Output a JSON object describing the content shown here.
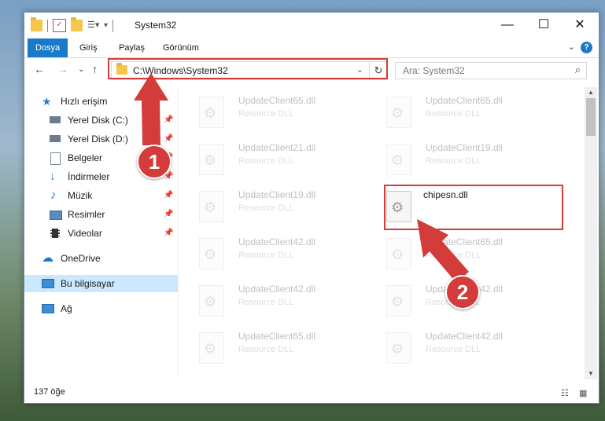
{
  "window": {
    "title": "System32",
    "controls": {
      "minimize": "—",
      "maximize": "☐",
      "close": "✕"
    }
  },
  "ribbon": {
    "tabs": [
      "Dosya",
      "Giriş",
      "Paylaş",
      "Görünüm"
    ],
    "active_tab": "Dosya",
    "help": "?"
  },
  "address": {
    "path": "C:\\Windows\\System32",
    "search_placeholder": "Ara: System32"
  },
  "sidebar": {
    "quick_access": "Hızlı erişim",
    "items": [
      {
        "label": "Yerel Disk (C:)",
        "icon": "drive-icon",
        "pinned": true
      },
      {
        "label": "Yerel Disk (D:)",
        "icon": "drive-icon",
        "pinned": true
      },
      {
        "label": "Belgeler",
        "icon": "documents-icon",
        "pinned": true
      },
      {
        "label": "İndirmeler",
        "icon": "downloads-icon",
        "pinned": true
      },
      {
        "label": "Müzik",
        "icon": "music-icon",
        "pinned": true
      },
      {
        "label": "Resimler",
        "icon": "pictures-icon",
        "pinned": true
      },
      {
        "label": "Videolar",
        "icon": "videos-icon",
        "pinned": true
      }
    ],
    "onedrive": "OneDrive",
    "this_pc": "Bu bilgisayar",
    "network": "Ağ"
  },
  "files": [
    {
      "name": "UpdateClient65.dll",
      "type": "Resource DLL",
      "highlighted": false
    },
    {
      "name": "UpdateClient65.dll",
      "type": "Resource DLL",
      "highlighted": false
    },
    {
      "name": "UpdateClient21.dll",
      "type": "Resource DLL",
      "highlighted": false
    },
    {
      "name": "UpdateClient19.dll",
      "type": "Resource DLL",
      "highlighted": false
    },
    {
      "name": "UpdateClient19.dll",
      "type": "Resource DLL",
      "highlighted": false
    },
    {
      "name": "chipesn.dll",
      "type": "",
      "highlighted": true
    },
    {
      "name": "UpdateClient42.dll",
      "type": "Resource DLL",
      "highlighted": false
    },
    {
      "name": "UpdateClient65.dll",
      "type": "Resource DLL",
      "highlighted": false
    },
    {
      "name": "UpdateClient42.dll",
      "type": "Resource DLL",
      "highlighted": false
    },
    {
      "name": "UpdateClient42.dll",
      "type": "Resource DLL",
      "highlighted": false
    },
    {
      "name": "UpdateClient65.dll",
      "type": "Resource DLL",
      "highlighted": false
    },
    {
      "name": "UpdateClient42.dll",
      "type": "Resource DLL",
      "highlighted": false
    }
  ],
  "status": {
    "item_count": "137 öğe"
  },
  "annotations": {
    "step1": "1",
    "step2": "2",
    "color": "#d43c3c"
  }
}
